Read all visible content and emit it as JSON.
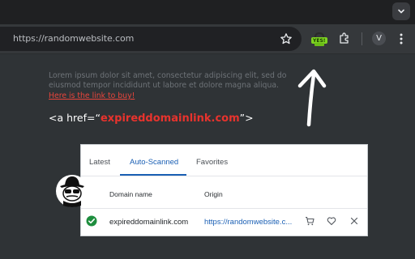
{
  "browser": {
    "url": "https://randomwebsite.com",
    "extension_badge": "YES!",
    "profile_initial": "V"
  },
  "page": {
    "lorem_text": "Lorem ipsum dolor sit amet, consectetur adipiscing elit, sed do eiusmod tempor incididunt ut labore et dolore magna aliqua.",
    "buy_link": "Here is the link to buy!",
    "anchor_prefix": "<a href=“",
    "anchor_domain": "expireddomainlink.com",
    "anchor_suffix": "”>"
  },
  "panel": {
    "tabs": [
      "Latest",
      "Auto-Scanned",
      "Favorites"
    ],
    "active_tab": "Auto-Scanned",
    "columns": {
      "domain": "Domain name",
      "origin": "Origin"
    },
    "rows": [
      {
        "status": "valid",
        "domain": "expireddomainlink.com",
        "origin": "https://randomwebsite.c..."
      }
    ]
  },
  "colors": {
    "accent": "#1a5fb4",
    "link_red": "#e8453c",
    "domain_red": "#e8332d",
    "check_green": "#1e8e3e",
    "badge_green": "#7ed321"
  },
  "icons": [
    "chevron-down-icon",
    "star-icon",
    "yes-extension-icon",
    "puzzle-icon",
    "kebab-menu-icon",
    "check-circle-icon",
    "cart-icon",
    "heart-icon",
    "close-icon",
    "spy-icon",
    "arrow-up-icon"
  ]
}
